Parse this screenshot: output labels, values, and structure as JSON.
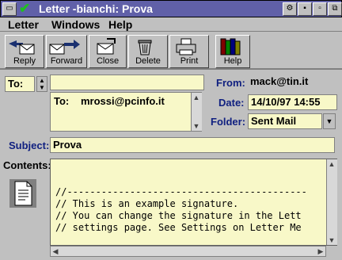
{
  "window": {
    "title": "Letter -bianchi: Prova"
  },
  "menu": {
    "letter": "Letter",
    "windows": "Windows",
    "help": "Help"
  },
  "toolbar": {
    "reply": "Reply",
    "forward": "Forward",
    "close": "Close",
    "delete": "Delete",
    "print": "Print",
    "help": "Help"
  },
  "header": {
    "to_select": "To:",
    "to_input": "",
    "recipients_label": "To:",
    "recipients_value": "mrossi@pcinfo.it",
    "from_label": "From:",
    "from_value": "mack@tin.it",
    "date_label": "Date:",
    "date_value": "14/10/97 14:55",
    "folder_label": "Folder:",
    "folder_value": "Sent Mail",
    "subject_label": "Subject:",
    "subject_value": "Prova",
    "contents_label": "Contents:"
  },
  "body": {
    "lines": [
      "//------------------------------------------",
      "// This is an example signature.",
      "// You can change the signature in the Lett",
      "// settings page. See Settings on Letter Me"
    ]
  },
  "colors": {
    "titlebar": "#6060a8",
    "field_bg": "#f8f8c8",
    "label_blue": "#102080"
  }
}
